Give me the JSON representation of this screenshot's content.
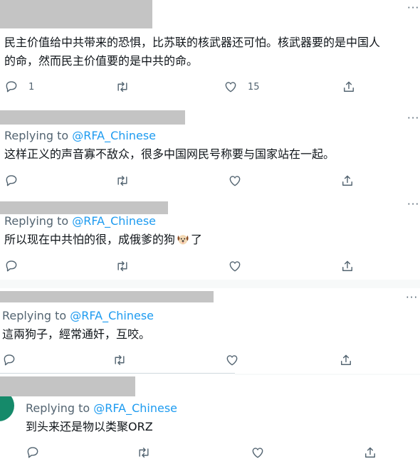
{
  "tweets": [
    {
      "text_line1": "民主价值给中共带来的恐惧，比苏联的核武器还可怕。核武器要的是中国人",
      "text_line2": "的命，然而民主价值要的是中共的命。",
      "reply_count": "1",
      "like_count": "15"
    },
    {
      "replying_prefix": "Replying to",
      "replying_handle": "@RFA_Chinese",
      "text": "这样正义的声音寡不敌众，很多中国网民号称要与国家站在一起。"
    },
    {
      "replying_prefix": "Replying to",
      "replying_handle": "@RFA_Chinese",
      "text": "所以现在中共怕的很，成俄爹的狗",
      "text_tail": "了",
      "emoji": "dog-face-icon"
    },
    {
      "replying_prefix": "Replying to",
      "replying_handle": "@RFA_Chinese",
      "text": "這兩狗子，經常通奸，互咬。"
    },
    {
      "replying_prefix": "Replying to",
      "replying_handle": "@RFA_Chinese",
      "text": "到头来还是物以类聚ORZ"
    }
  ],
  "icons": [
    "reply-icon",
    "retweet-icon",
    "like-icon",
    "share-icon",
    "more-icon"
  ],
  "colors": {
    "link": "#1d9bf0",
    "secondary": "#536471",
    "redaction": "#c4c4c4",
    "avatar": "#158a6a"
  }
}
